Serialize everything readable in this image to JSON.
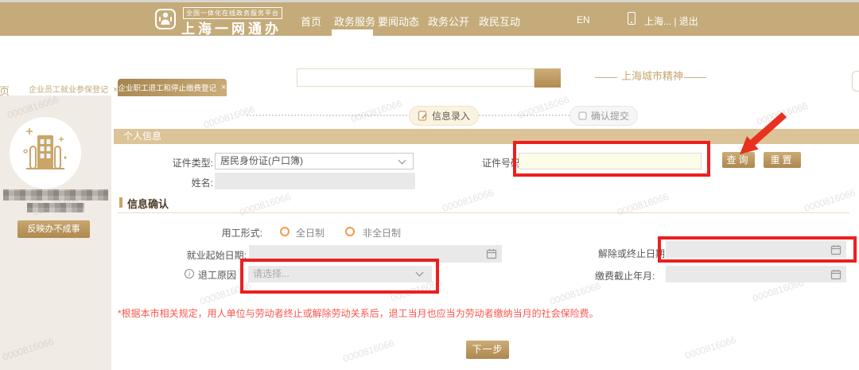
{
  "icons": {
    "close": "×",
    "info": "i"
  },
  "watermark": "0000816066",
  "header": {
    "platform_badge": "全国一体化在线政务服务平台",
    "site_title": "上海一网通办",
    "nav": [
      {
        "label": "首页"
      },
      {
        "label": "政务服务"
      },
      {
        "label": "要闻动态"
      },
      {
        "label": "政务公开"
      },
      {
        "label": "政民互动"
      }
    ],
    "lang": "EN",
    "user": "上海... | 退出"
  },
  "subheader": {
    "section_title": "上海城市精神"
  },
  "tabs": [
    {
      "label": "首页"
    },
    {
      "label": "企业员工就业参保登记"
    },
    {
      "label": "企业职工退工和停止缴费登记"
    }
  ],
  "sidebar": {
    "feedback_button": "反映办不成事"
  },
  "steps": [
    {
      "label": "信息录入"
    },
    {
      "label": "确认提交"
    }
  ],
  "form": {
    "section_personal": "个人信息",
    "cert_type_label": "证件类型:",
    "cert_type_value": "居民身份证(户口簿)",
    "cert_no_label": "证件号码",
    "query_button": "查询",
    "reset_button": "重置",
    "name_label": "姓名:",
    "section_confirm": "信息确认",
    "employment_label": "用工形式:",
    "employment_options": [
      "全日制",
      "非全日制"
    ],
    "start_date_label": "就业起始日期:",
    "end_date_label": "解除或终止日期",
    "quit_reason_label": "退工原因",
    "quit_reason_placeholder": "请选择...",
    "fee_month_label": "缴费截止年月:",
    "warning": "*根据本市相关规定，用人单位与劳动者终止或解除劳动关系后，退工当月也应当为劳动者缴纳当月的社会保险费。",
    "next_button": "下一步"
  }
}
